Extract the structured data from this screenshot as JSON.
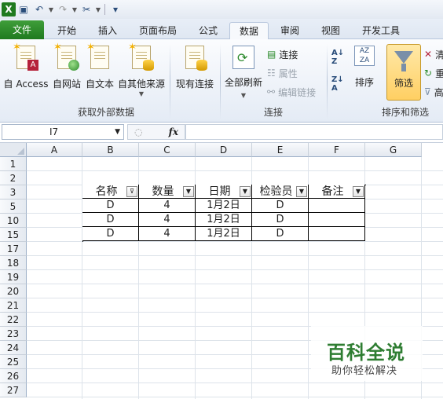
{
  "quick_access": {
    "undo": "↶",
    "redo": "↷",
    "more": "▾"
  },
  "tabs": [
    {
      "label": "文件"
    },
    {
      "label": "开始"
    },
    {
      "label": "插入"
    },
    {
      "label": "页面布局"
    },
    {
      "label": "公式"
    },
    {
      "label": "数据"
    },
    {
      "label": "审阅"
    },
    {
      "label": "视图"
    },
    {
      "label": "开发工具"
    }
  ],
  "active_tab": "数据",
  "ribbon": {
    "get_external": {
      "label": "获取外部数据",
      "buttons": [
        "自 Access",
        "自网站",
        "自文本",
        "自其他来源"
      ],
      "existing": "现有连接"
    },
    "connections": {
      "label": "连接",
      "refresh_all": "全部刷新",
      "connections": "连接",
      "properties": "属性",
      "edit_links": "编辑链接"
    },
    "sort_filter": {
      "label": "排序和筛选",
      "sort": "排序",
      "filter": "筛选",
      "clear_partial": "清",
      "reapply_partial": "重",
      "advanced_partial": "高"
    }
  },
  "formula_bar": {
    "name_box": "I7",
    "fx": "fx",
    "formula": ""
  },
  "columns": [
    "A",
    "B",
    "C",
    "D",
    "E",
    "F",
    "G"
  ],
  "rows": [
    "1",
    "2",
    "3",
    "5",
    "10",
    "15",
    "17",
    "18",
    "19",
    "20",
    "21",
    "22",
    "23",
    "24",
    "25",
    "26",
    "27"
  ],
  "table": {
    "headers": [
      "名称",
      "数量",
      "日期",
      "检验员",
      "备注"
    ],
    "rows": [
      [
        "D",
        "4",
        "1月2日",
        "D",
        ""
      ],
      [
        "D",
        "4",
        "1月2日",
        "D",
        ""
      ],
      [
        "D",
        "4",
        "1月2日",
        "D",
        ""
      ]
    ]
  },
  "watermark": {
    "title": "百科全说",
    "subtitle": "助你轻松解决"
  }
}
